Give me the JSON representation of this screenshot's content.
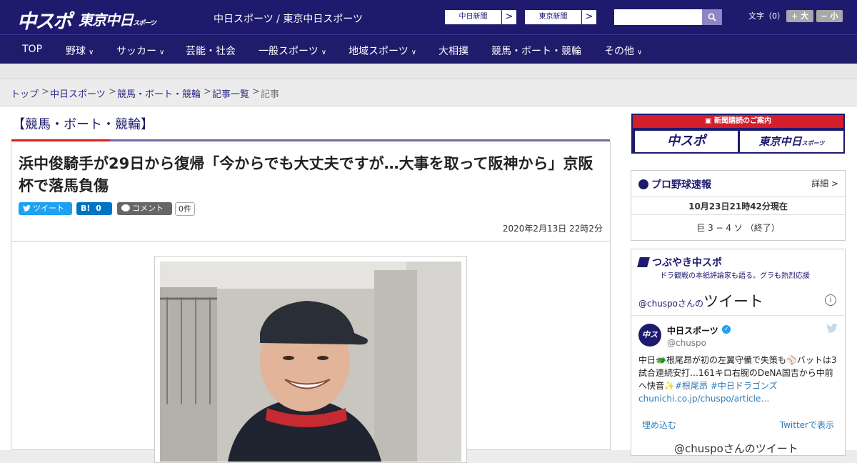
{
  "header": {
    "logo_chuspo": "中スポ",
    "logo_tokyo": "東京中日",
    "logo_tokyo_small": "スポーツ",
    "site_links": "中日スポーツ / 東京中日スポーツ",
    "paper_buttons": [
      {
        "label": "中日新聞",
        "arrow": ">"
      },
      {
        "label": "東京新聞",
        "arrow": ">"
      }
    ],
    "search_placeholder": "",
    "font_size_label": "文字（0）",
    "font_larger": "+ 大",
    "font_smaller": "− 小"
  },
  "nav": [
    {
      "label": "TOP",
      "has_menu": false
    },
    {
      "label": "野球",
      "has_menu": true
    },
    {
      "label": "サッカー",
      "has_menu": true
    },
    {
      "label": "芸能・社会",
      "has_menu": false
    },
    {
      "label": "一般スポーツ",
      "has_menu": true
    },
    {
      "label": "地域スポーツ",
      "has_menu": true
    },
    {
      "label": "大相撲",
      "has_menu": false
    },
    {
      "label": "競馬・ボート・競輪",
      "has_menu": false
    },
    {
      "label": "その他",
      "has_menu": true
    }
  ],
  "breadcrumb": {
    "items": [
      "トップ",
      "中日スポーツ",
      "競馬・ボート・競輪",
      "記事一覧"
    ],
    "separator": ">",
    "current": "記事"
  },
  "article": {
    "category": "【競馬・ボート・競輪】",
    "headline": "浜中俊騎手が29日から復帰「今からでも大丈夫ですが…大事を取って阪神から」京阪杯で落馬負傷",
    "share": {
      "tweet": "ツイート",
      "hatena_label": "B!",
      "hatena_count": "0",
      "comment": "コメント",
      "comment_count": "0件"
    },
    "date": "2020年2月13日 22時2分"
  },
  "sidebar": {
    "subscribe": {
      "header": "新聞購読のご案内",
      "left": "中スポ",
      "right": "東京中日",
      "right_small": "スポーツ"
    },
    "baseball": {
      "title": "プロ野球速報",
      "more": "詳細 >",
      "time": "10月23日21時42分現在",
      "score": "巨 3 − 4 ソ （終了）"
    },
    "tweets": {
      "title": "つぶやき中スポ",
      "subtitle": "ドラ観戦の本紙評論家も語る。グラも熱烈応援",
      "header_handle": "@chuspoさんの",
      "header_big": "ツイート",
      "info": "i",
      "account_name": "中日スポーツ",
      "account_handle": "@chuspo",
      "avatar_text": "中スポ",
      "tweet_text": "中日🐲根尾昂が初の左翼守備で失策も⚾バットは3試合連続安打…161キロ右腕のDeNA国吉から中前へ快音✨",
      "hashtags": "#根尾昂 #中日ドラゴンズ",
      "link": "chunichi.co.jp/chuspo/article…",
      "embed": "埋め込む",
      "view_on_twitter": "Twitterで表示",
      "footer": "@chuspoさんのツイート"
    }
  },
  "colors": {
    "brand_navy": "#1e1a6e",
    "accent_red": "#d4201c",
    "twitter_blue": "#1da1f2"
  }
}
